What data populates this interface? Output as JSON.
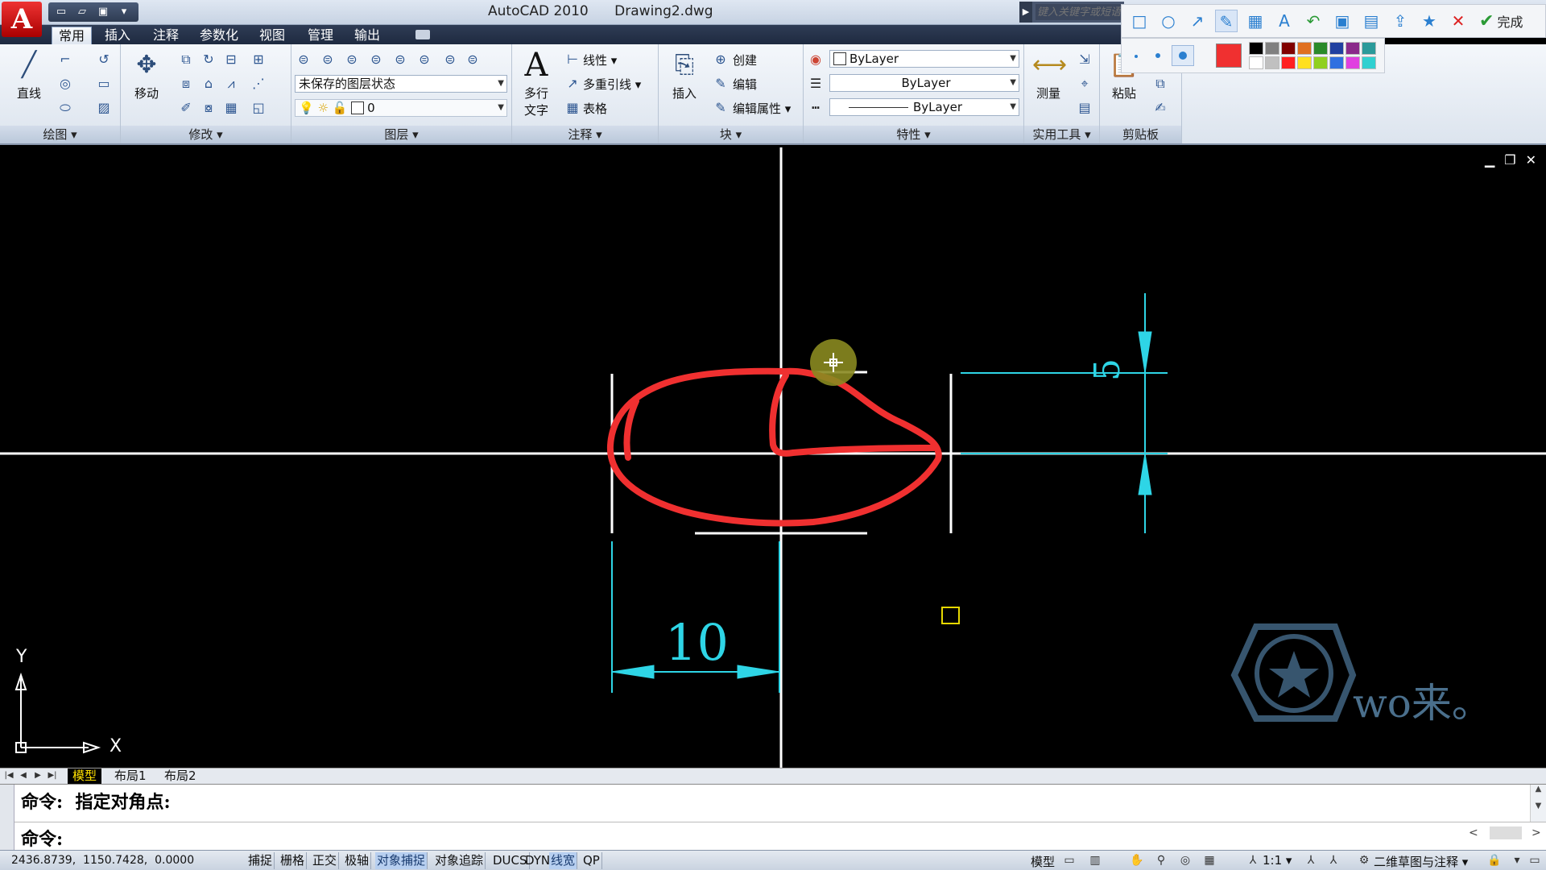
{
  "title_bar": {
    "app_name": "AutoCAD 2010",
    "document": "Drawing2.dwg",
    "search_placeholder": "键入关键字或短语"
  },
  "annot_toolbar": {
    "icons": [
      "rectangle-icon",
      "ellipse-icon",
      "arrow-icon",
      "pen-icon",
      "mosaic-icon",
      "text-icon",
      "undo-icon",
      "save-icon",
      "pin-icon",
      "share-icon",
      "star-icon",
      "close-icon"
    ],
    "done_label": "完成",
    "current_color": "#f03030",
    "swatches": [
      "#000000",
      "#808080",
      "#800000",
      "#e07020",
      "#2a8a2a",
      "#2040a0",
      "#8a2a8a",
      "#2a9a9a",
      "#ffffff",
      "#c0c0c0",
      "#ff2020",
      "#ffe020",
      "#90d020",
      "#3070e0",
      "#e040e0",
      "#30d0d0"
    ]
  },
  "menu": {
    "tabs": [
      "常用",
      "插入",
      "注释",
      "参数化",
      "视图",
      "管理",
      "输出"
    ],
    "active": "常用"
  },
  "ribbon": {
    "draw": {
      "title": "绘图",
      "line": "直线"
    },
    "modify": {
      "title": "修改",
      "move": "移动"
    },
    "layers": {
      "title": "图层",
      "layer_state": "未保存的图层状态",
      "layer_current": "0"
    },
    "annotation": {
      "title": "注释",
      "mtext_1": "多行",
      "mtext_2": "文字",
      "linear": "线性",
      "mleader": "多重引线",
      "table": "表格"
    },
    "block": {
      "title": "块",
      "insert": "插入",
      "create": "创建",
      "edit": "编辑",
      "edit_attr": "编辑属性"
    },
    "properties": {
      "title": "特性",
      "color": "ByLayer",
      "linetype": "ByLayer",
      "lineweight": "ByLayer"
    },
    "utilities": {
      "title": "实用工具",
      "measure": "测量"
    },
    "clipboard": {
      "title": "剪贴板",
      "paste": "粘贴"
    }
  },
  "drawing": {
    "dim_horizontal": "10",
    "dim_vertical": "5",
    "axis_x": "X",
    "axis_y": "Y",
    "watermark": "wo来。",
    "dim_color": "#2ed5e6",
    "markup_color": "#f03030"
  },
  "layout_tabs": [
    "模型",
    "布局1",
    "布局2"
  ],
  "command": {
    "line1": "命令:  指定对角点:",
    "line2": "命令:"
  },
  "status": {
    "coords": "2436.8739,  1150.7428,  0.0000",
    "toggles": [
      {
        "label": "捕捉",
        "on": false
      },
      {
        "label": "栅格",
        "on": false
      },
      {
        "label": "正交",
        "on": false
      },
      {
        "label": "极轴",
        "on": false
      },
      {
        "label": "对象捕捉",
        "on": true
      },
      {
        "label": "对象追踪",
        "on": false
      },
      {
        "label": "DUCS",
        "on": false
      },
      {
        "label": "DYN",
        "on": false
      },
      {
        "label": "线宽",
        "on": true
      },
      {
        "label": "QP",
        "on": false
      }
    ],
    "model_label": "模型",
    "scale": "1:1",
    "workspace": "二维草图与注释"
  }
}
